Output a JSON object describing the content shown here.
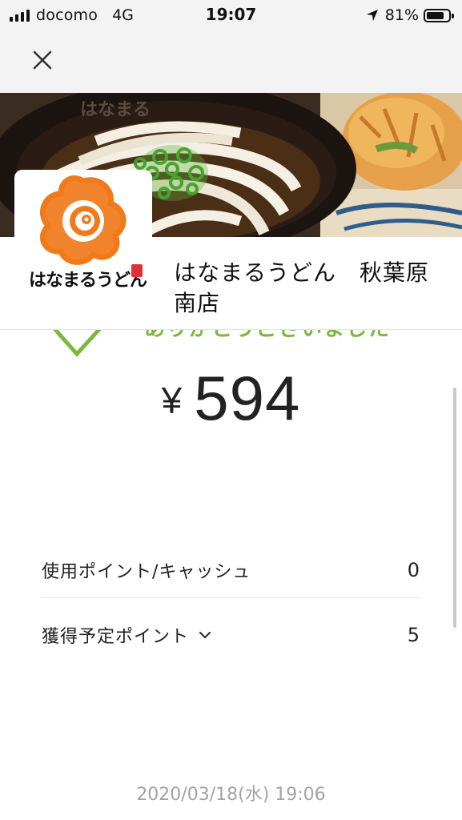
{
  "status_bar": {
    "carrier": "docomo",
    "network": "4G",
    "time": "19:07",
    "battery": "81%",
    "battery_level": 0.81
  },
  "nav": {
    "close_icon": "close-icon"
  },
  "shop": {
    "logo_text": "はなまるうどん",
    "name": "はなまるうどん　秋葉原南店"
  },
  "payment": {
    "thanks": "ありがとうございました",
    "currency": "¥",
    "amount": "594"
  },
  "details": {
    "points_used_label": "使用ポイント/キャッシュ",
    "points_used_value": "0",
    "points_earned_label": "獲得予定ポイント",
    "points_earned_value": "5"
  },
  "timestamp": "2020/03/18(水) 19:06",
  "colors": {
    "accent_green": "#7ab93a",
    "logo_orange": "#f07a1a"
  }
}
